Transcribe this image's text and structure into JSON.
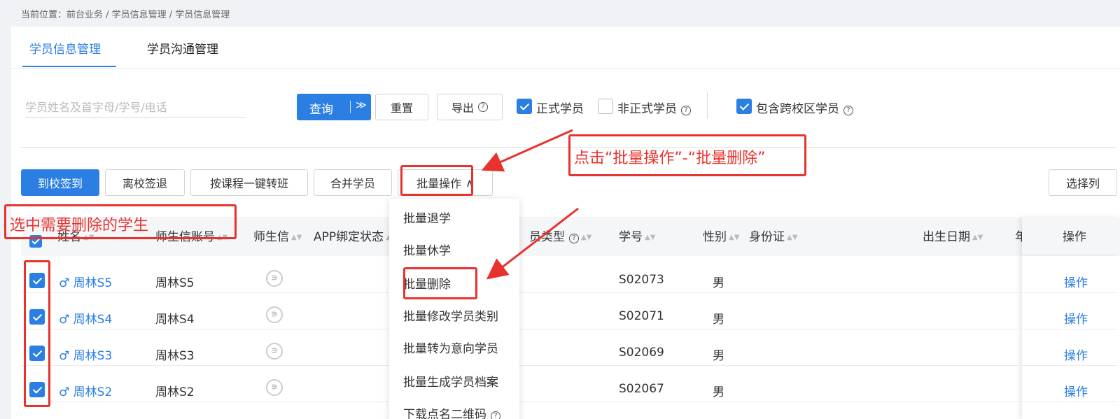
{
  "breadcrumb": "当前位置：前台业务 / 学员信息管理 / 学员信息管理",
  "tabs": [
    "学员信息管理",
    "学员沟通管理"
  ],
  "search": {
    "placeholder": "学员姓名及首字母/学号/电话"
  },
  "filters": {
    "query": "查询",
    "reset": "重置",
    "export": "导出",
    "formal": "正式学员",
    "informal": "非正式学员",
    "cross_campus": "包含跨校区学员"
  },
  "toolbar": {
    "checkin": "到校签到",
    "checkout": "离校签退",
    "transfer": "按课程一键转班",
    "merge": "合并学员",
    "batch": "批量操作",
    "select_columns": "选择列"
  },
  "dropdown": [
    "批量退学",
    "批量休学",
    "批量删除",
    "批量修改学员类别",
    "批量转为意向学员",
    "批量生成学员档案",
    "下载点名二维码"
  ],
  "columns": {
    "name": "姓名",
    "account": "师生信账号",
    "wechat": "师生信",
    "app": "APP绑定状态",
    "type": "员类型",
    "id": "学号",
    "gender": "性别",
    "idcard": "身份证",
    "birthday": "出生日期",
    "age": "年龄",
    "op": "操作"
  },
  "rows": [
    {
      "name": "周林S5",
      "account": "周林S5",
      "id": "S02073",
      "gender": "男",
      "op": "操作"
    },
    {
      "name": "周林S4",
      "account": "周林S4",
      "id": "S02071",
      "gender": "男",
      "op": "操作"
    },
    {
      "name": "周林S3",
      "account": "周林S3",
      "id": "S02069",
      "gender": "男",
      "op": "操作"
    },
    {
      "name": "周林S2",
      "account": "周林S2",
      "id": "S02067",
      "gender": "男",
      "op": "操作"
    }
  ],
  "annotations": {
    "top": "点击“批量操作”-“批量删除”",
    "left": "选中需要删除的学生"
  },
  "colors": {
    "primary": "#2b7fe3",
    "annotation": "#e8322e"
  }
}
